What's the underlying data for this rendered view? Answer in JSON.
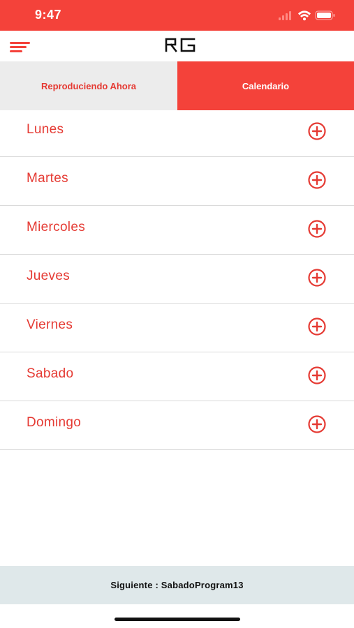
{
  "status_bar": {
    "time": "9:47"
  },
  "header": {
    "logo_text": "RG"
  },
  "tabs": [
    {
      "label": "Reproduciendo Ahora",
      "active": false
    },
    {
      "label": "Calendario",
      "active": true
    }
  ],
  "days": [
    {
      "label": "Lunes"
    },
    {
      "label": "Martes"
    },
    {
      "label": "Miercoles"
    },
    {
      "label": "Jueves"
    },
    {
      "label": "Viernes"
    },
    {
      "label": "Sabado"
    },
    {
      "label": "Domingo"
    }
  ],
  "footer": {
    "next_label": "Siguiente : SabadoProgram13"
  },
  "colors": {
    "accent": "#f4423a",
    "text_red": "#e53a33",
    "footer_bg": "#dfe8ea"
  },
  "icons": {
    "menu": "hamburger-menu-icon",
    "add": "plus-circle-icon",
    "wifi": "wifi-icon",
    "battery": "battery-icon",
    "signal": "signal-icon"
  }
}
